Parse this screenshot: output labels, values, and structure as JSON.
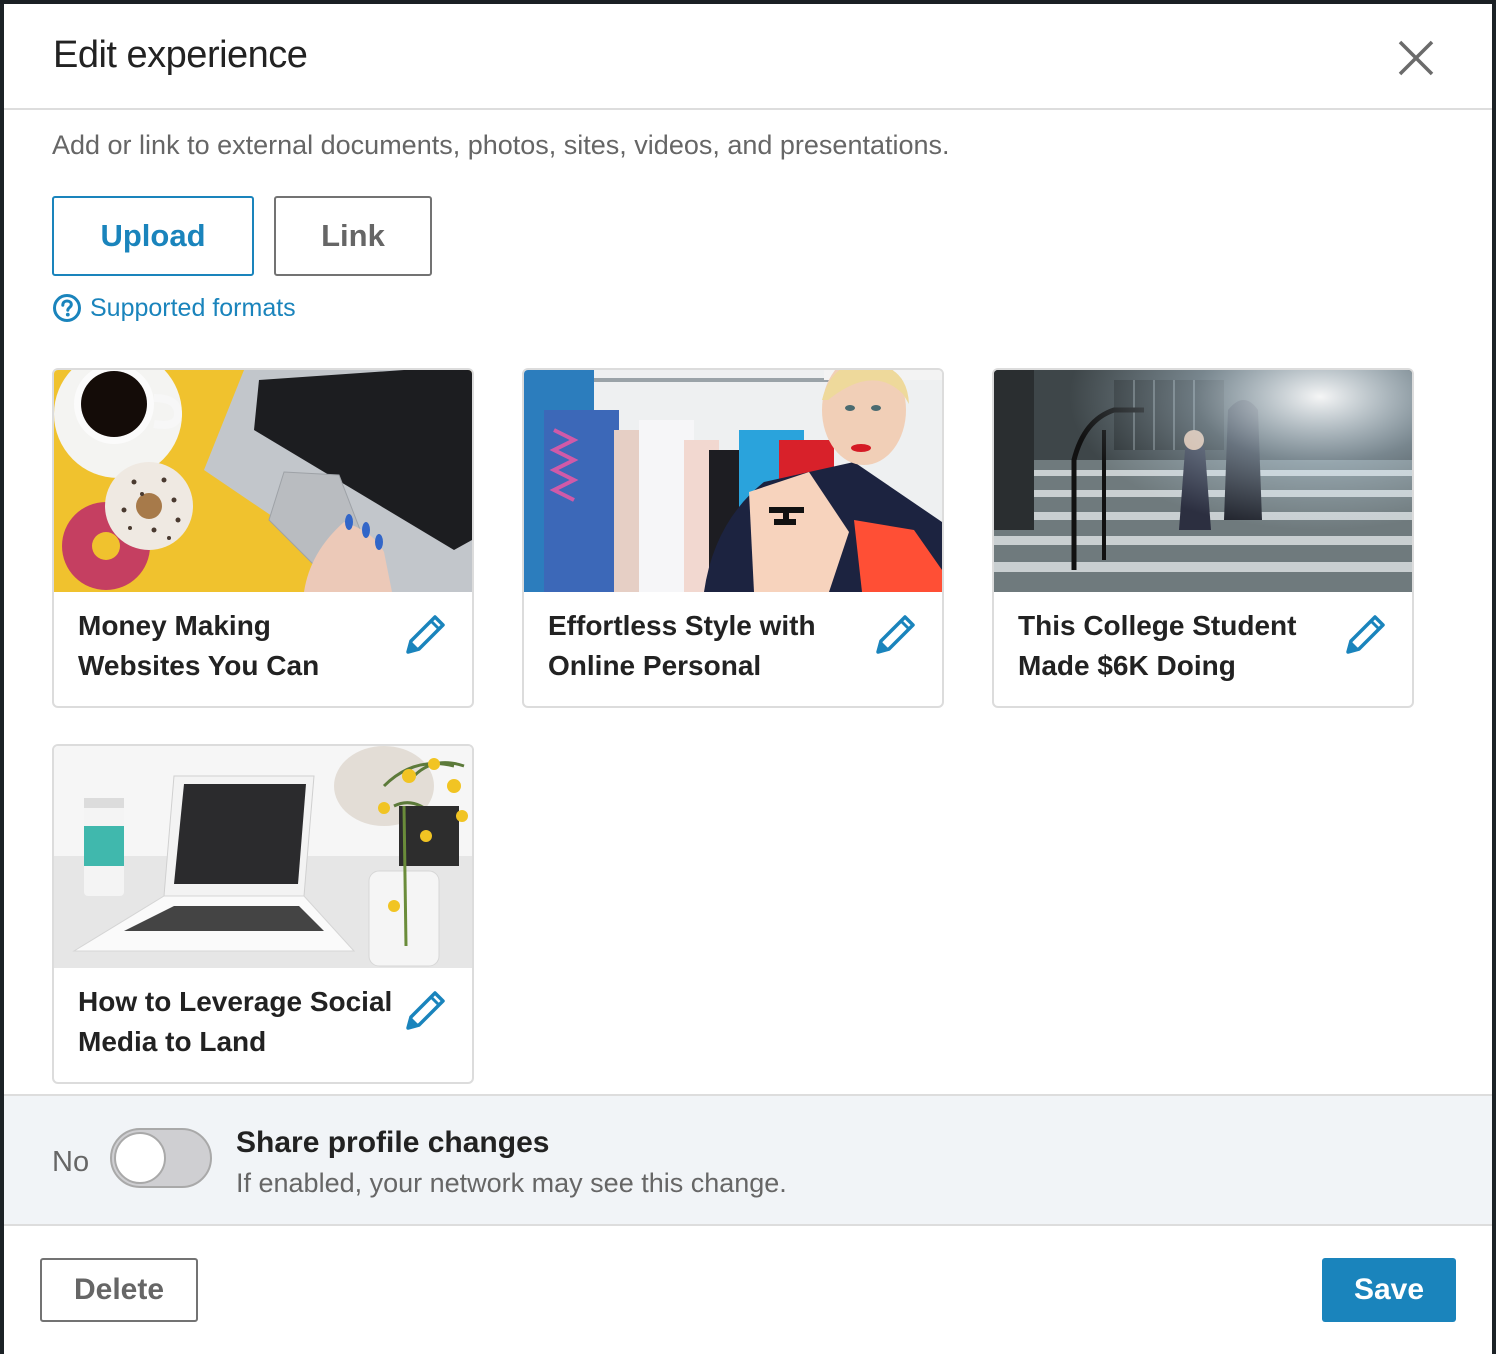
{
  "modal": {
    "title": "Edit experience",
    "close_icon": "close-icon"
  },
  "media": {
    "intro": "Add or link to external documents, photos, sites, videos, and presentations.",
    "upload_label": "Upload",
    "link_label": "Link",
    "supported_formats_label": "Supported formats",
    "supported_formats_icon": "question-circle-icon"
  },
  "cards": [
    {
      "caption": "Money Making Websites You Can",
      "thumbnail": "laptop-coffee-donuts-photo",
      "edit_icon": "pencil-icon"
    },
    {
      "caption": "Effortless Style with Online Personal",
      "thumbnail": "woman-clothes-rack-photo",
      "edit_icon": "pencil-icon"
    },
    {
      "caption": "This College Student Made $6K Doing",
      "thumbnail": "campus-stairs-photo",
      "edit_icon": "pencil-icon"
    },
    {
      "caption": "How to Leverage Social Media to Land",
      "thumbnail": "white-laptop-desk-photo",
      "edit_icon": "pencil-icon"
    }
  ],
  "share": {
    "state_label": "No",
    "enabled": false,
    "title": "Share profile changes",
    "subtitle": "If enabled, your network may see this change."
  },
  "footer": {
    "delete_label": "Delete",
    "save_label": "Save"
  },
  "colors": {
    "accent": "#1a84bc",
    "text_primary": "#222222",
    "text_secondary": "#666666",
    "share_bg": "#f1f4f7"
  }
}
